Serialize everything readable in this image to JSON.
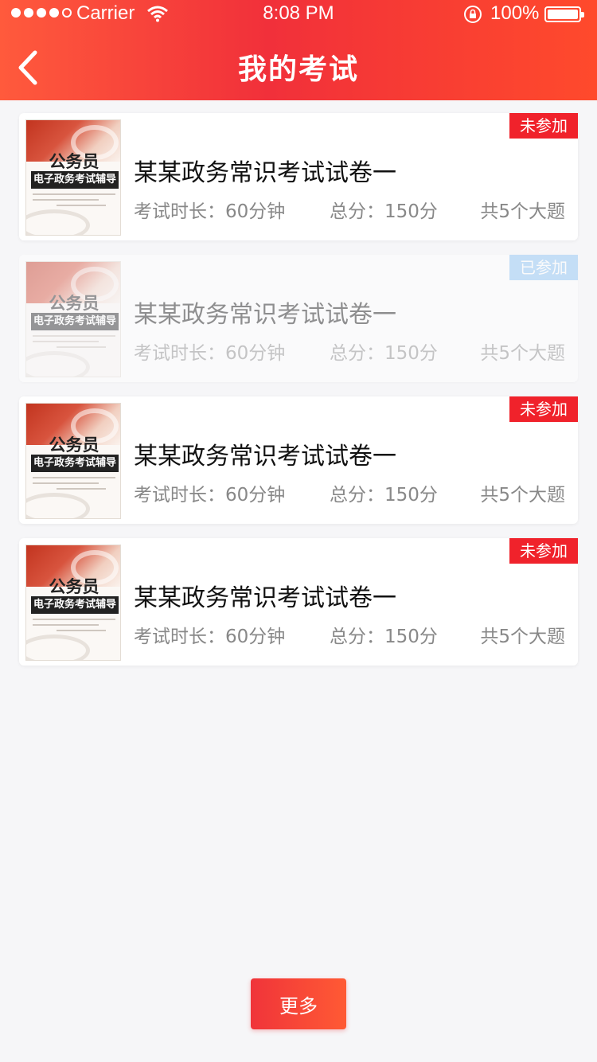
{
  "status_bar": {
    "carrier": "Carrier",
    "time": "8:08 PM",
    "battery": "100%"
  },
  "nav": {
    "title": "我的考试",
    "back_icon": "chevron-left-icon"
  },
  "cover": {
    "title": "公务员",
    "subtitle": "电子政务考试辅导"
  },
  "exams": [
    {
      "title": "某某政务常识考试试卷一",
      "duration": "考试时长：60分钟",
      "score": "总分：150分",
      "questions": "共5个大题",
      "status": "未参加"
    },
    {
      "title": "某某政务常识考试试卷一",
      "duration": "考试时长：60分钟",
      "score": "总分：150分",
      "questions": "共5个大题",
      "status": "已参加"
    },
    {
      "title": "某某政务常识考试试卷一",
      "duration": "考试时长：60分钟",
      "score": "总分：150分",
      "questions": "共5个大题",
      "status": "未参加"
    },
    {
      "title": "某某政务常识考试试卷一",
      "duration": "考试时长：60分钟",
      "score": "总分：150分",
      "questions": "共5个大题",
      "status": "未参加"
    }
  ],
  "more_button": "更多",
  "colors": {
    "brand_red": "#f0222b",
    "participated_blue": "#7dbcf3"
  }
}
